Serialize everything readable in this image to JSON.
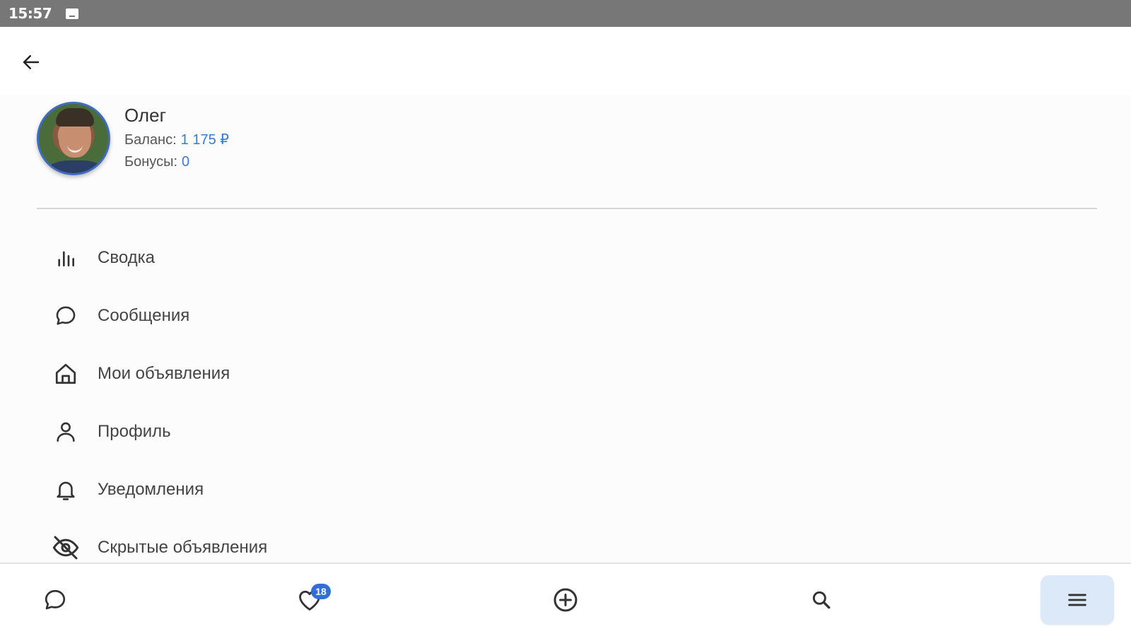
{
  "status_bar": {
    "time": "15:57",
    "notification_icon": "image-notification-icon"
  },
  "header": {
    "back_icon": "arrow-left-icon"
  },
  "profile": {
    "name": "Олег",
    "balance_label": "Баланс:",
    "balance_value": "1 175 ₽",
    "bonus_label": "Бонусы:",
    "bonus_value": "0"
  },
  "menu": {
    "items": [
      {
        "label": "Сводка",
        "icon": "bar-chart-icon"
      },
      {
        "label": "Сообщения",
        "icon": "chat-bubble-icon"
      },
      {
        "label": "Мои объявления",
        "icon": "home-icon"
      },
      {
        "label": "Профиль",
        "icon": "person-icon"
      },
      {
        "label": "Уведомления",
        "icon": "bell-icon"
      },
      {
        "label": "Скрытые объявления",
        "icon": "eye-off-icon"
      }
    ]
  },
  "bottom_nav": {
    "favorites_badge": "18",
    "items": [
      {
        "icon": "chat-bubble-icon"
      },
      {
        "icon": "heart-icon"
      },
      {
        "icon": "plus-circle-icon"
      },
      {
        "icon": "search-icon"
      },
      {
        "icon": "menu-icon",
        "active": true
      }
    ]
  },
  "colors": {
    "accent": "#3a7bd5",
    "status_bar": "#777777",
    "active_nav_bg": "#dbe9f9"
  }
}
